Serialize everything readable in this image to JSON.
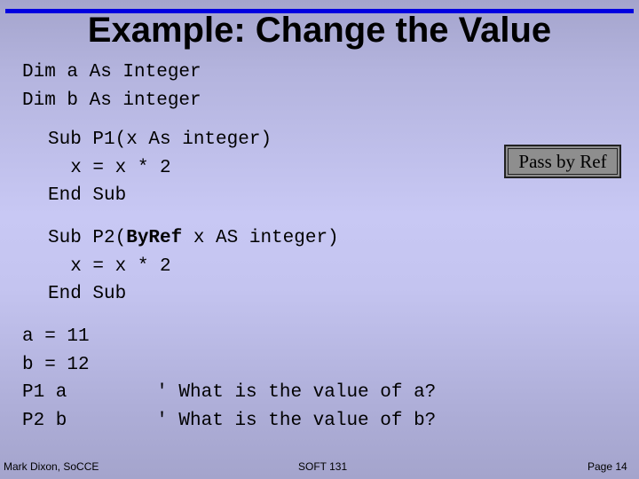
{
  "slide": {
    "title": "Example: Change the Value",
    "decl": [
      "Dim a As Integer",
      "Dim b As integer"
    ],
    "sub1": [
      "Sub P1(x As integer)",
      "  x = x * 2",
      "End Sub"
    ],
    "sub2": {
      "line1_pre": "Sub P2(",
      "line1_bold": "ByRef",
      "line1_post": " x AS integer)",
      "line2": "  x = x * 2",
      "line3": "End Sub"
    },
    "main": [
      "a = 11",
      "b = 12",
      "P1 a        ' What is the value of a?",
      "P2 b        ' What is the value of b?"
    ],
    "callout": "Pass by Ref",
    "footer": {
      "left": "Mark Dixon, SoCCE",
      "center": "SOFT 131",
      "right": "Page 14"
    }
  }
}
